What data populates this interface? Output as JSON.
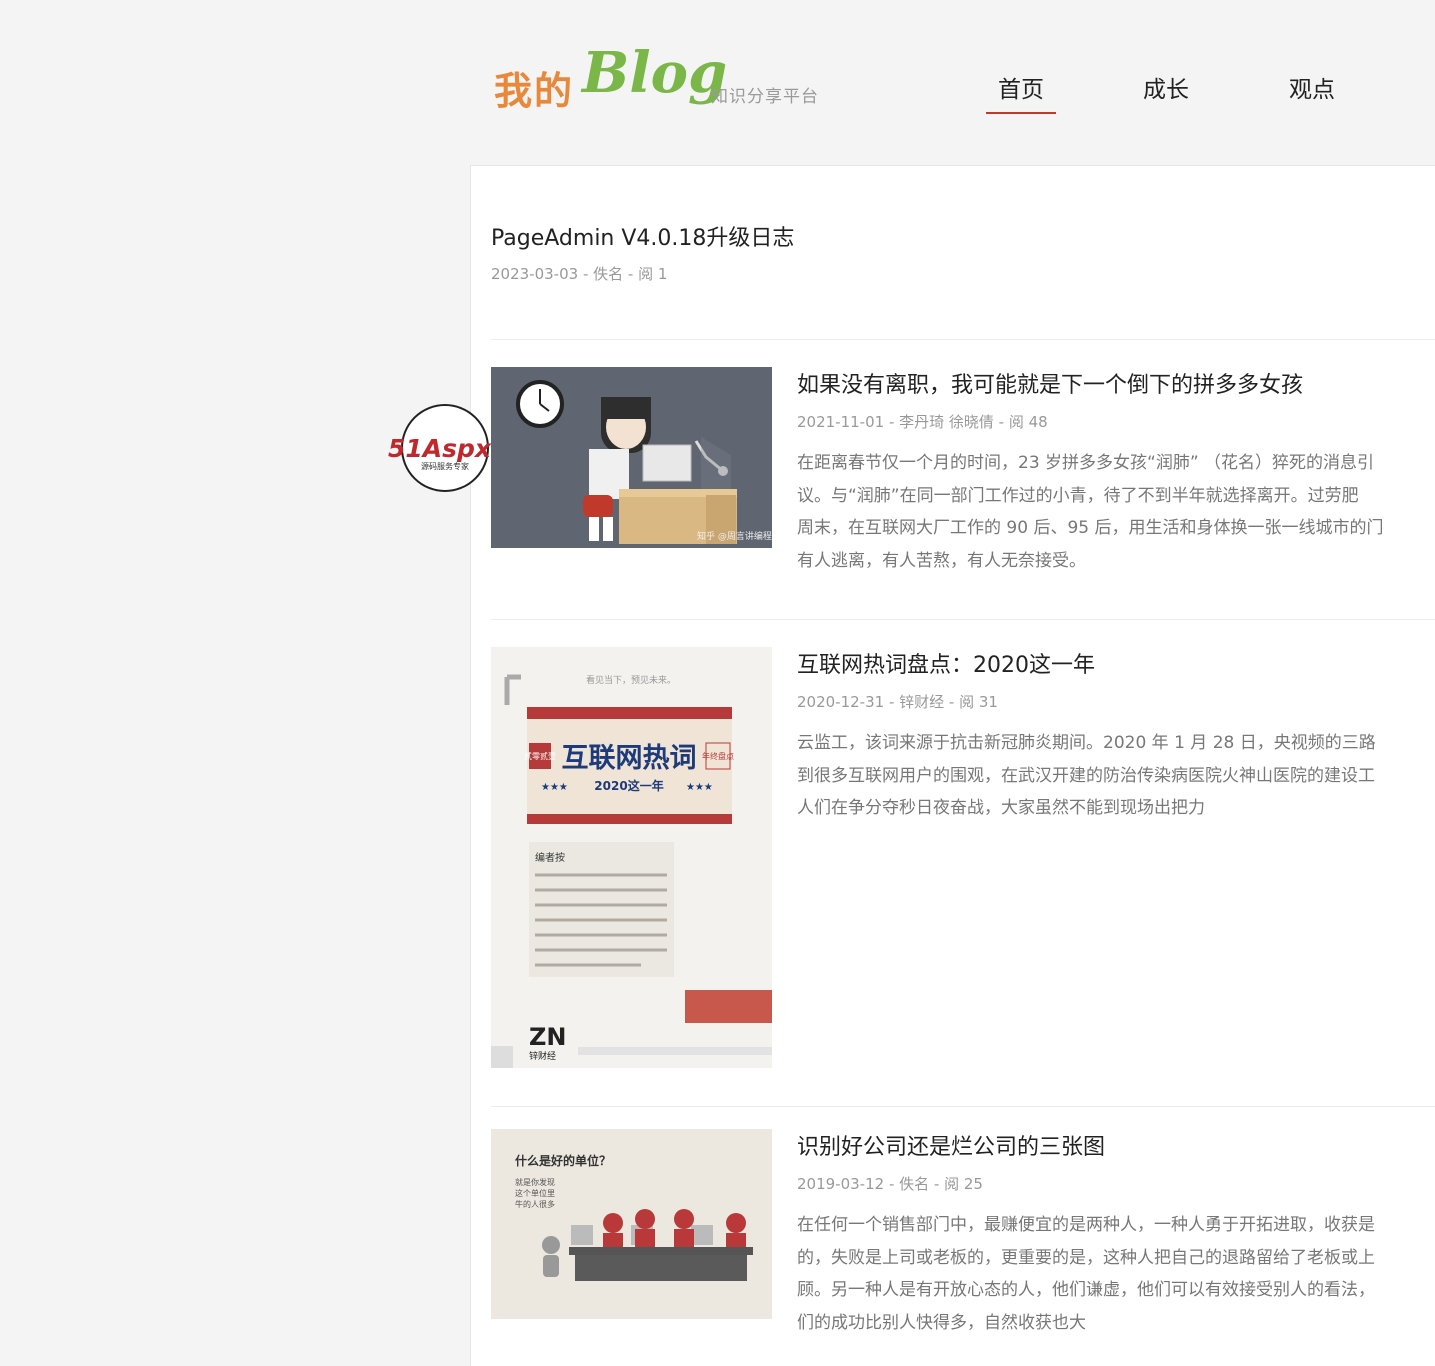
{
  "header": {
    "logo_main": "我的",
    "logo_blog": "Blog",
    "logo_sub": "知识分享平台",
    "nav": [
      "首页",
      "成长",
      "观点"
    ]
  },
  "top_post": {
    "title": "PageAdmin V4.0.18升级日志",
    "meta": "2023-03-03 - 佚名 - 阅 1"
  },
  "posts": [
    {
      "title": "如果没有离职，我可能就是下一个倒下的拼多多女孩",
      "meta": "2021-11-01 - 李丹琦 徐晓倩 - 阅 48",
      "summary": [
        "在距离春节仅一个月的时间，23 岁拼多多女孩“润肺” （花名）猝死的消息引",
        "议。与“润肺”在同一部门工作过的小青，待了不到半年就选择离开。过劳肥",
        "周末，在互联网大厂工作的 90 后、95 后，用生活和身体换一张一线城市的门",
        "有人逃离，有人苦熬，有人无奈接受。"
      ],
      "thumb_caption": "知乎 @周言讲编程"
    },
    {
      "title": "互联网热词盘点：2020这一年",
      "meta": "2020-12-31 - 锌财经 - 阅 31",
      "summary": [
        "云监工，该词来源于抗击新冠肺炎期间。2020 年 1 月 28 日，央视频的三路",
        "到很多互联网用户的围观，在武汉开建的防治传染病医院火神山医院的建设工",
        "人们在争分夺秒日夜奋战，大家虽然不能到现场出把力"
      ],
      "thumb_top": "看见当下，预见未来。",
      "thumb_banner": "互联网热词",
      "thumb_left": "贰零贰壹",
      "thumb_right": "年终盘点",
      "thumb_sub": "2020这一年",
      "thumb_editor": "编者按",
      "thumb_brand": "锌财经"
    },
    {
      "title": "识别好公司还是烂公司的三张图",
      "meta": "2019-03-12 - 佚名 - 阅 25",
      "summary": [
        "在任何一个销售部门中，最赚便宜的是两种人，一种人勇于开拓进取，收获是",
        "的，失败是上司或老板的，更重要的是，这种人把自己的退路留给了老板或上",
        "顾。另一种人是有开放心态的人，他们谦虚，他们可以有效接受别人的看法，",
        "们的成功比别人快得多，自然收获也大"
      ],
      "thumb_title": "什么是好的单位？",
      "thumb_lines": [
        "就是你发现",
        "这个单位里",
        "牛的人很多"
      ]
    }
  ],
  "badge": {
    "brand": "51Aspx",
    "sub": "源码服务专家"
  }
}
